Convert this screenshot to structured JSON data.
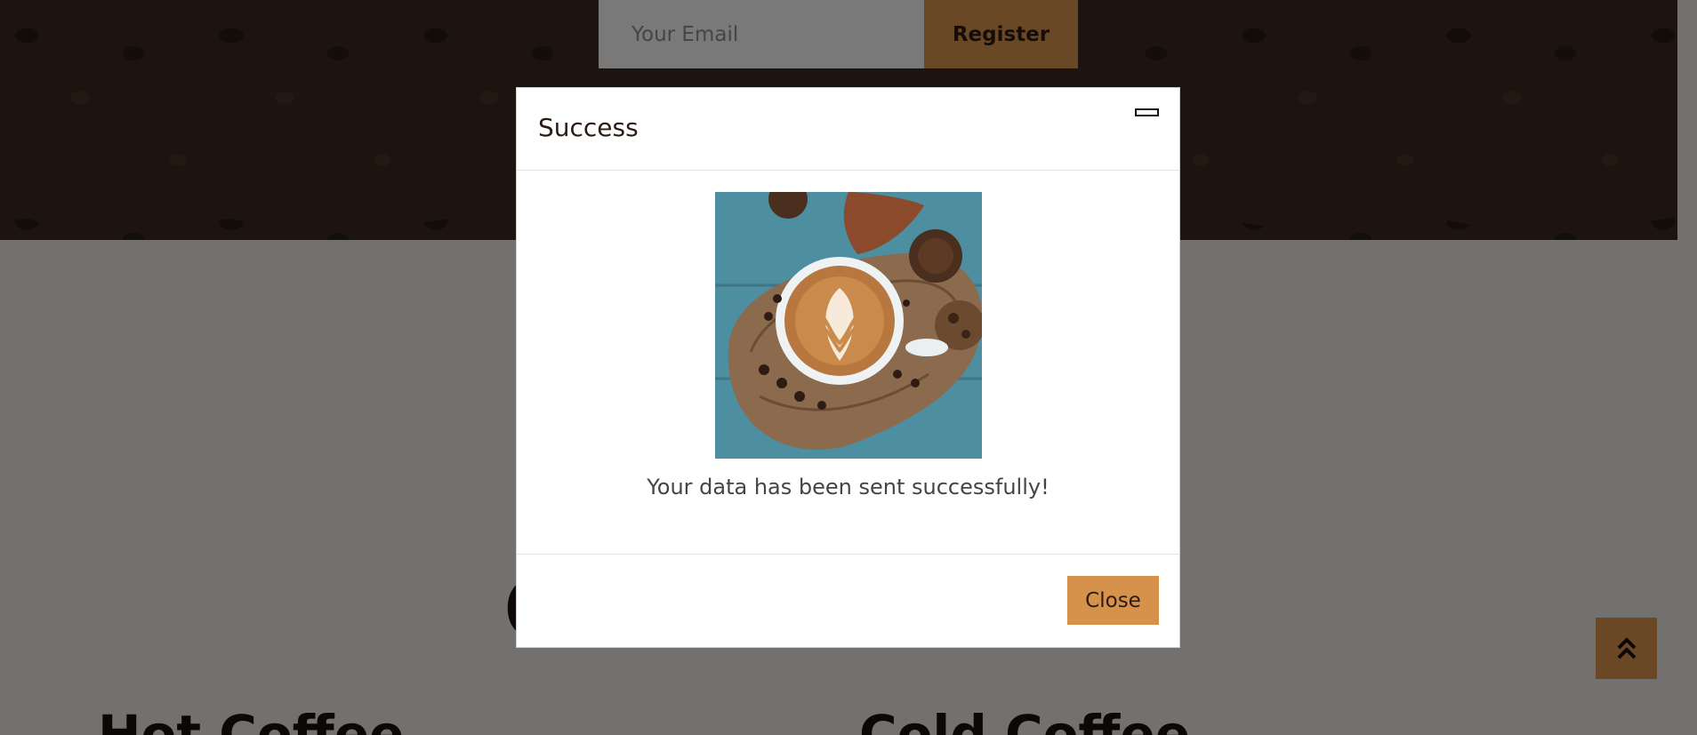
{
  "newsletter": {
    "email_placeholder": "Your Email",
    "register_label": "Register"
  },
  "background": {
    "partial_heading": "C",
    "hot_coffee_heading": "Hot Coffee",
    "cold_coffee_heading": "Cold Coffee"
  },
  "modal": {
    "title": "Success",
    "message": "Your data has been sent successfully!",
    "close_label": "Close"
  },
  "icons": {
    "close": "close-icon",
    "scroll_top": "double-chevron-up-icon"
  },
  "colors": {
    "accent": "#d6914b",
    "dark_brown": "#2b1b14",
    "overlay": "rgba(0,0,0,0.5)"
  }
}
